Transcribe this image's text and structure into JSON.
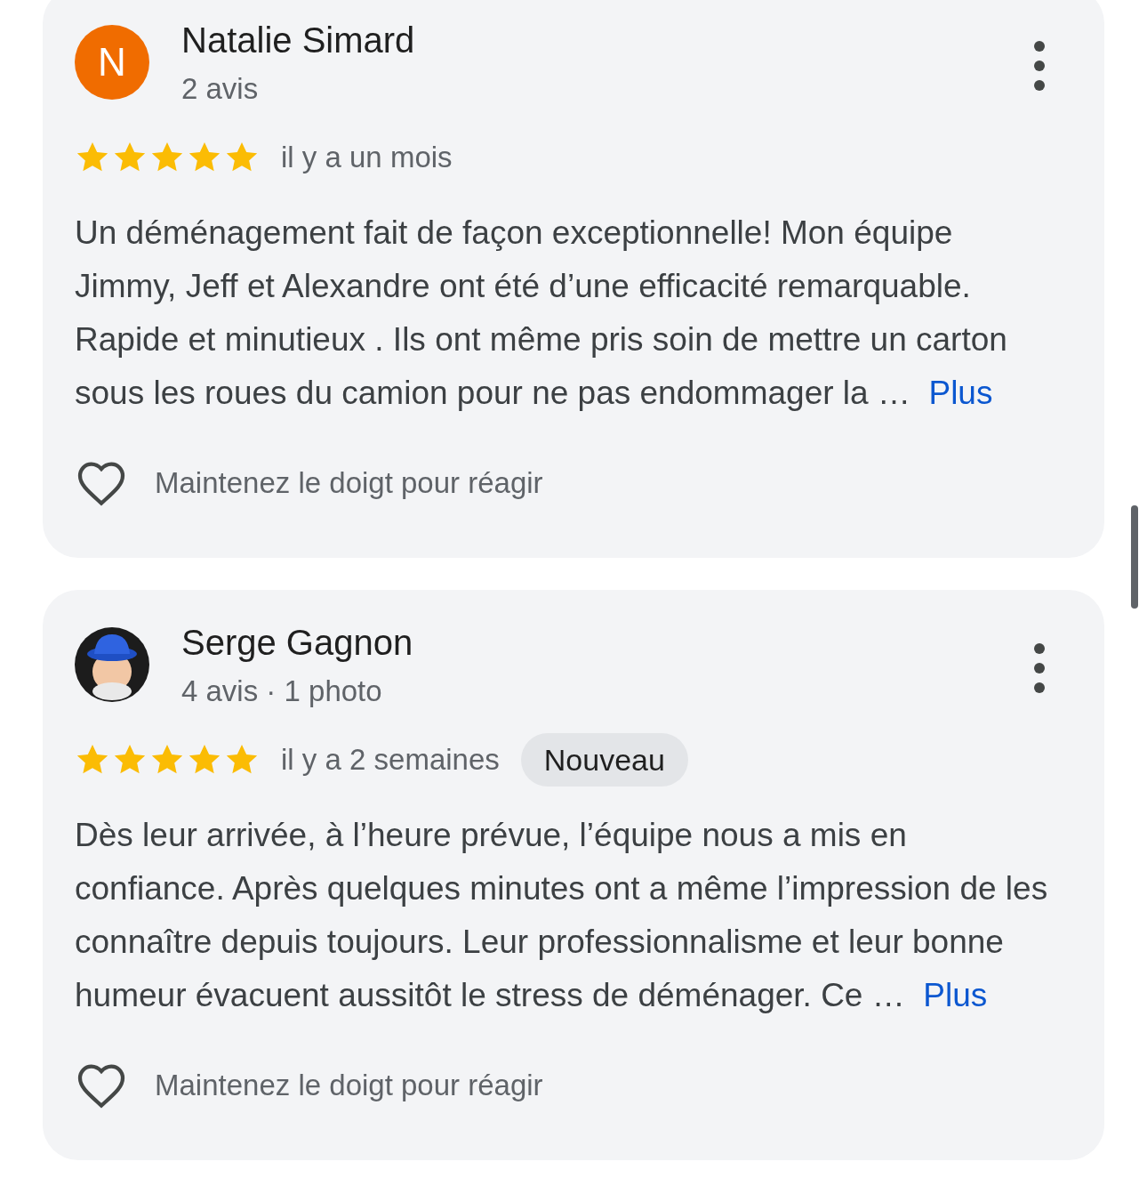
{
  "reviews": [
    {
      "avatar": {
        "kind": "letter",
        "letter": "N",
        "color": "#f06c00"
      },
      "name": "Natalie Simard",
      "meta": "2 avis",
      "stars": 5,
      "time": "il y a un mois",
      "text": "Un déménagement fait de façon exceptionnelle! Mon équipe Jimmy, Jeff et Alexandre ont été d’une efficacité remarquable. Rapide et minutieux . Ils ont même pris soin de mettre un carton sous les roues du camion pour ne pas endommager la …",
      "more": "Plus",
      "react": "Maintenez le doigt pour réagir"
    },
    {
      "avatar": {
        "kind": "figure"
      },
      "name": "Serge Gagnon",
      "meta": "4 avis · 1 photo",
      "stars": 5,
      "time": "il y a 2 semaines",
      "badge": "Nouveau",
      "text": "Dès leur arrivée, à l’heure prévue, l’équipe nous a mis en confiance. Après quelques minutes ont a même l’impression de les connaître depuis toujours. Leur professionnalisme et leur bonne humeur évacuent aussitôt le stress de déménager. Ce …",
      "more": "Plus",
      "react": "Maintenez le doigt pour réagir"
    }
  ]
}
